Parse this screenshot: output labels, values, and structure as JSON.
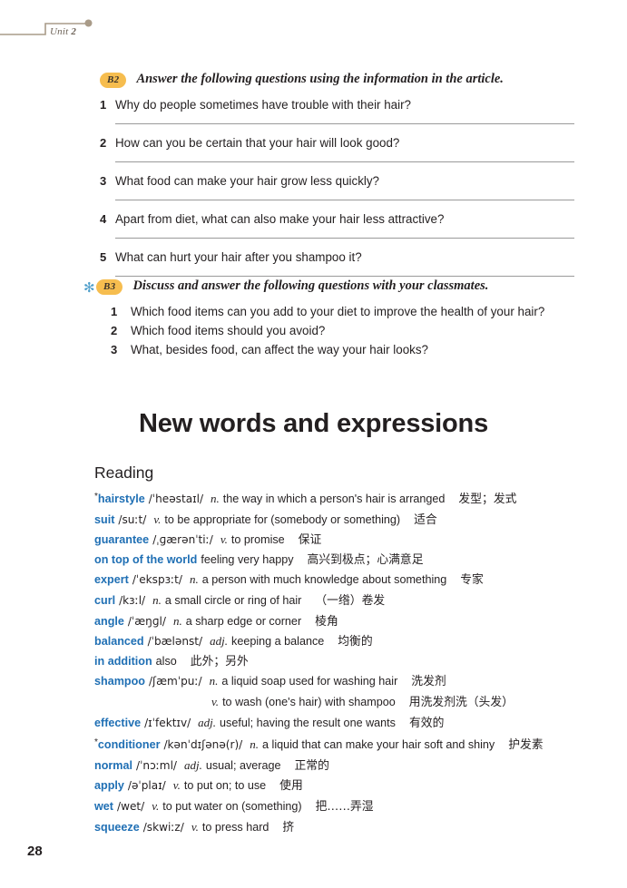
{
  "running_head": {
    "unit_label": "Unit",
    "unit_number": "2"
  },
  "exercises": [
    {
      "id": "B2",
      "badge": "B2",
      "has_star": false,
      "instruction": "Answer the following questions using the information in the article.",
      "questions": [
        {
          "num": "1",
          "text": "Why do people sometimes have trouble with their hair?"
        },
        {
          "num": "2",
          "text": "How can you be certain that your hair will look good?"
        },
        {
          "num": "3",
          "text": "What food can make your hair grow less quickly?"
        },
        {
          "num": "4",
          "text": "Apart from diet, what can also make your hair less attractive?"
        },
        {
          "num": "5",
          "text": "What can hurt your hair after you shampoo it?"
        }
      ]
    },
    {
      "id": "B3",
      "badge": "B3",
      "has_star": true,
      "star_glyph": "✻",
      "instruction": "Discuss and answer the following questions with your classmates.",
      "questions": [
        {
          "num": "1",
          "text": "Which food items can you add to your diet to improve the health of your hair?"
        },
        {
          "num": "2",
          "text": "Which food items should you avoid?"
        },
        {
          "num": "3",
          "text": "What, besides food, can affect the way your hair looks?"
        }
      ]
    }
  ],
  "section": {
    "title": "New words and expressions",
    "subsection": "Reading"
  },
  "vocabulary": [
    {
      "star": "*",
      "word": "hairstyle",
      "ipa": "/ˈheəstaɪl/",
      "pos": "n.",
      "definition": "the way in which a person's hair is arranged",
      "chinese": "发型；发式"
    },
    {
      "star": "",
      "word": "suit",
      "ipa": "/suːt/",
      "pos": "v.",
      "definition": "to be appropriate for (somebody or something)",
      "chinese": "适合"
    },
    {
      "star": "",
      "word": "guarantee",
      "ipa": "/ˌɡærənˈtiː/",
      "pos": "v.",
      "definition": "to promise",
      "chinese": "保证"
    },
    {
      "star": "",
      "word": "on top of the world",
      "ipa": "",
      "pos": "",
      "definition": "feeling very happy",
      "chinese": "高兴到极点；心满意足"
    },
    {
      "star": "",
      "word": "expert",
      "ipa": "/ˈekspɜːt/",
      "pos": "n.",
      "definition": "a person with much knowledge about something",
      "chinese": "专家"
    },
    {
      "star": "",
      "word": "curl",
      "ipa": "/kɜːl/",
      "pos": "n.",
      "definition": "a small circle or ring of hair",
      "chinese": "（一绺）卷发"
    },
    {
      "star": "",
      "word": "angle",
      "ipa": "/ˈæŋɡl/",
      "pos": "n.",
      "definition": "a sharp edge or corner",
      "chinese": "棱角"
    },
    {
      "star": "",
      "word": "balanced",
      "ipa": "/ˈbælənst/",
      "pos": "adj.",
      "definition": "keeping a balance",
      "chinese": "均衡的"
    },
    {
      "star": "",
      "word": "in addition",
      "ipa": "",
      "pos": "",
      "definition": "also",
      "chinese": "此外；另外"
    },
    {
      "star": "",
      "word": "shampoo",
      "ipa": "/ʃæmˈpuː/",
      "pos": "n.",
      "definition": "a liquid soap used for washing hair",
      "chinese": "洗发剂"
    },
    {
      "star": "",
      "word": "",
      "ipa": "",
      "pos": "v.",
      "definition": "to wash (one's hair) with shampoo",
      "chinese": "用洗发剂洗（头发）",
      "continuation": true
    },
    {
      "star": "",
      "word": "effective",
      "ipa": "/ɪˈfektɪv/",
      "pos": "adj.",
      "definition": "useful; having the result one wants",
      "chinese": "有效的"
    },
    {
      "star": "*",
      "word": "conditioner",
      "ipa": "/kənˈdɪʃənə(r)/",
      "pos": "n.",
      "definition": "a liquid that can make your hair soft and shiny",
      "chinese": "护发素"
    },
    {
      "star": "",
      "word": "normal",
      "ipa": "/ˈnɔːml/",
      "pos": "adj.",
      "definition": "usual; average",
      "chinese": "正常的"
    },
    {
      "star": "",
      "word": "apply",
      "ipa": "/əˈplaɪ/",
      "pos": "v.",
      "definition": "to put on; to use",
      "chinese": "使用"
    },
    {
      "star": "",
      "word": "wet",
      "ipa": "/wet/",
      "pos": "v.",
      "definition": "to put water on (something)",
      "chinese": "把……弄湿"
    },
    {
      "star": "",
      "word": "squeeze",
      "ipa": "/skwiːz/",
      "pos": "v.",
      "definition": "to press hard",
      "chinese": "挤"
    }
  ],
  "folio": "28",
  "colors": {
    "badge_orange": "#f6bd4f",
    "headword_blue": "#1f6fb4",
    "star_blue": "#4f9fcb",
    "rule_gray": "#9a9a9a",
    "runhead_tan": "#a99b88"
  }
}
